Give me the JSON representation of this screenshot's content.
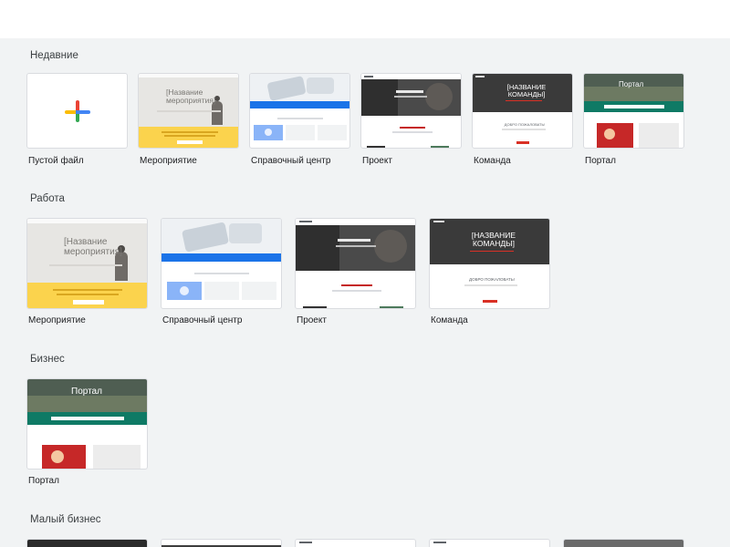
{
  "sections": {
    "recent": {
      "title": "Недавние"
    },
    "work": {
      "title": "Работа"
    },
    "business": {
      "title": "Бизнес"
    },
    "small_business": {
      "title": "Малый бизнес"
    }
  },
  "recent": [
    {
      "label": "Пустой файл"
    },
    {
      "label": "Мероприятие"
    },
    {
      "label": "Справочный центр"
    },
    {
      "label": "Проект"
    },
    {
      "label": "Команда"
    },
    {
      "label": "Портал"
    }
  ],
  "work": [
    {
      "label": "Мероприятие"
    },
    {
      "label": "Справочный центр"
    },
    {
      "label": "Проект"
    },
    {
      "label": "Команда"
    }
  ],
  "business": [
    {
      "label": "Портал"
    }
  ],
  "thumb_text": {
    "event_title": "[Название мероприятия]",
    "team_title": "[НАЗВАНИЕ КОМАНДЫ]",
    "team_welcome": "ДОБРО ПОЖАЛОВАТЬ!",
    "portal_title": "Портал"
  },
  "colors": {
    "plus_blue": "#4285f4",
    "plus_red": "#ea4335",
    "plus_yellow": "#fbbc04",
    "plus_green": "#34a853",
    "help_blue": "#1a73e8",
    "event_yellow": "#fbd34d",
    "team_dark": "#3a3a3a",
    "team_red": "#d93025",
    "portal_green": "#0f7a65"
  }
}
